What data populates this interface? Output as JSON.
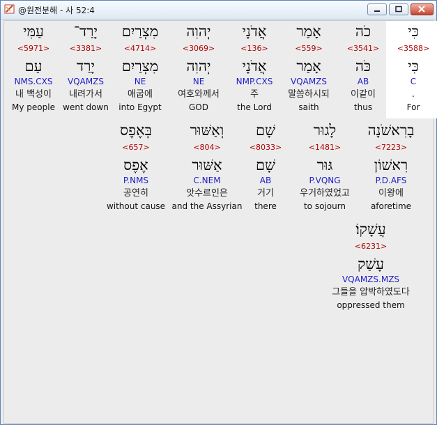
{
  "window": {
    "title": "@원전분해 - 사 52:4",
    "icon": "bible-tool-icon",
    "buttons": [
      "minimize",
      "maximize",
      "close"
    ]
  },
  "words": [
    {
      "heb": "כִּי",
      "strong": "<3588>",
      "lemma": "כִּי",
      "morph": "C",
      "kor": ".",
      "eng": "For",
      "selected": true
    },
    {
      "heb": "כֹה",
      "strong": "<3541>",
      "lemma": "כֹּה",
      "morph": "AB",
      "kor": "이같이",
      "eng": "thus"
    },
    {
      "heb": "אָמַר",
      "strong": "<559>",
      "lemma": "אָמַר",
      "morph": "VQAMZS",
      "kor": "말씀하시되",
      "eng": "saith"
    },
    {
      "heb": "אֲדֹנָי",
      "strong": "<136>",
      "lemma": "אֲדֹנָי",
      "morph": "NMP.CXS",
      "kor": "주",
      "eng": "the Lord"
    },
    {
      "heb": "יְהוִה",
      "strong": "<3069>",
      "lemma": "יְהוִה",
      "morph": "NE",
      "kor": "여호와께서",
      "eng": "GOD"
    },
    {
      "heb": "מִצְרַיִם",
      "strong": "<4714>",
      "lemma": "מִצְרַיִם",
      "morph": "NE",
      "kor": "애굽에",
      "eng": "into Egypt"
    },
    {
      "heb": "יָרַד־",
      "strong": "<3381>",
      "lemma": "יָרַד",
      "morph": "VQAMZS",
      "kor": "내려가서",
      "eng": "went down"
    },
    {
      "heb": "עַמִּי",
      "strong": "<5971>",
      "lemma": "עַם",
      "morph": "NMS.CXS",
      "kor": "내 백성이",
      "eng": "My people"
    },
    {
      "heb": "בָרִאשֹׁנָה",
      "strong": "<7223>",
      "lemma": "רִאשׁוֹן",
      "morph": "P.D.AFS",
      "kor": "이왕에",
      "eng": "aforetime"
    },
    {
      "heb": "לָגוּר",
      "strong": "<1481>",
      "lemma": "גּוּר",
      "morph": "P.VQNG",
      "kor": "우거하였었고",
      "eng": "to sojourn"
    },
    {
      "heb": "שָׁם",
      "strong": "<8033>",
      "lemma": "שָׁם",
      "morph": "AB",
      "kor": "거기",
      "eng": "there"
    },
    {
      "heb": "וְאַשּׁוּר",
      "strong": "<804>",
      "lemma": "אַשּׁוּר",
      "morph": "C.NEM",
      "kor": "앗수르인은",
      "eng": "and the Assyrian"
    },
    {
      "heb": "בְּאֶפֶס",
      "strong": "<657>",
      "lemma": "אֶפֶס",
      "morph": "P.NMS",
      "kor": "공연히",
      "eng": "without cause"
    },
    {
      "heb": "עֲשָׁקוֹ׃",
      "strong": "<6231>",
      "lemma": "עָשַׁק",
      "morph": "VQAMZS.MZS",
      "kor": "그들을 압박하였도다",
      "eng": "oppressed them"
    }
  ]
}
